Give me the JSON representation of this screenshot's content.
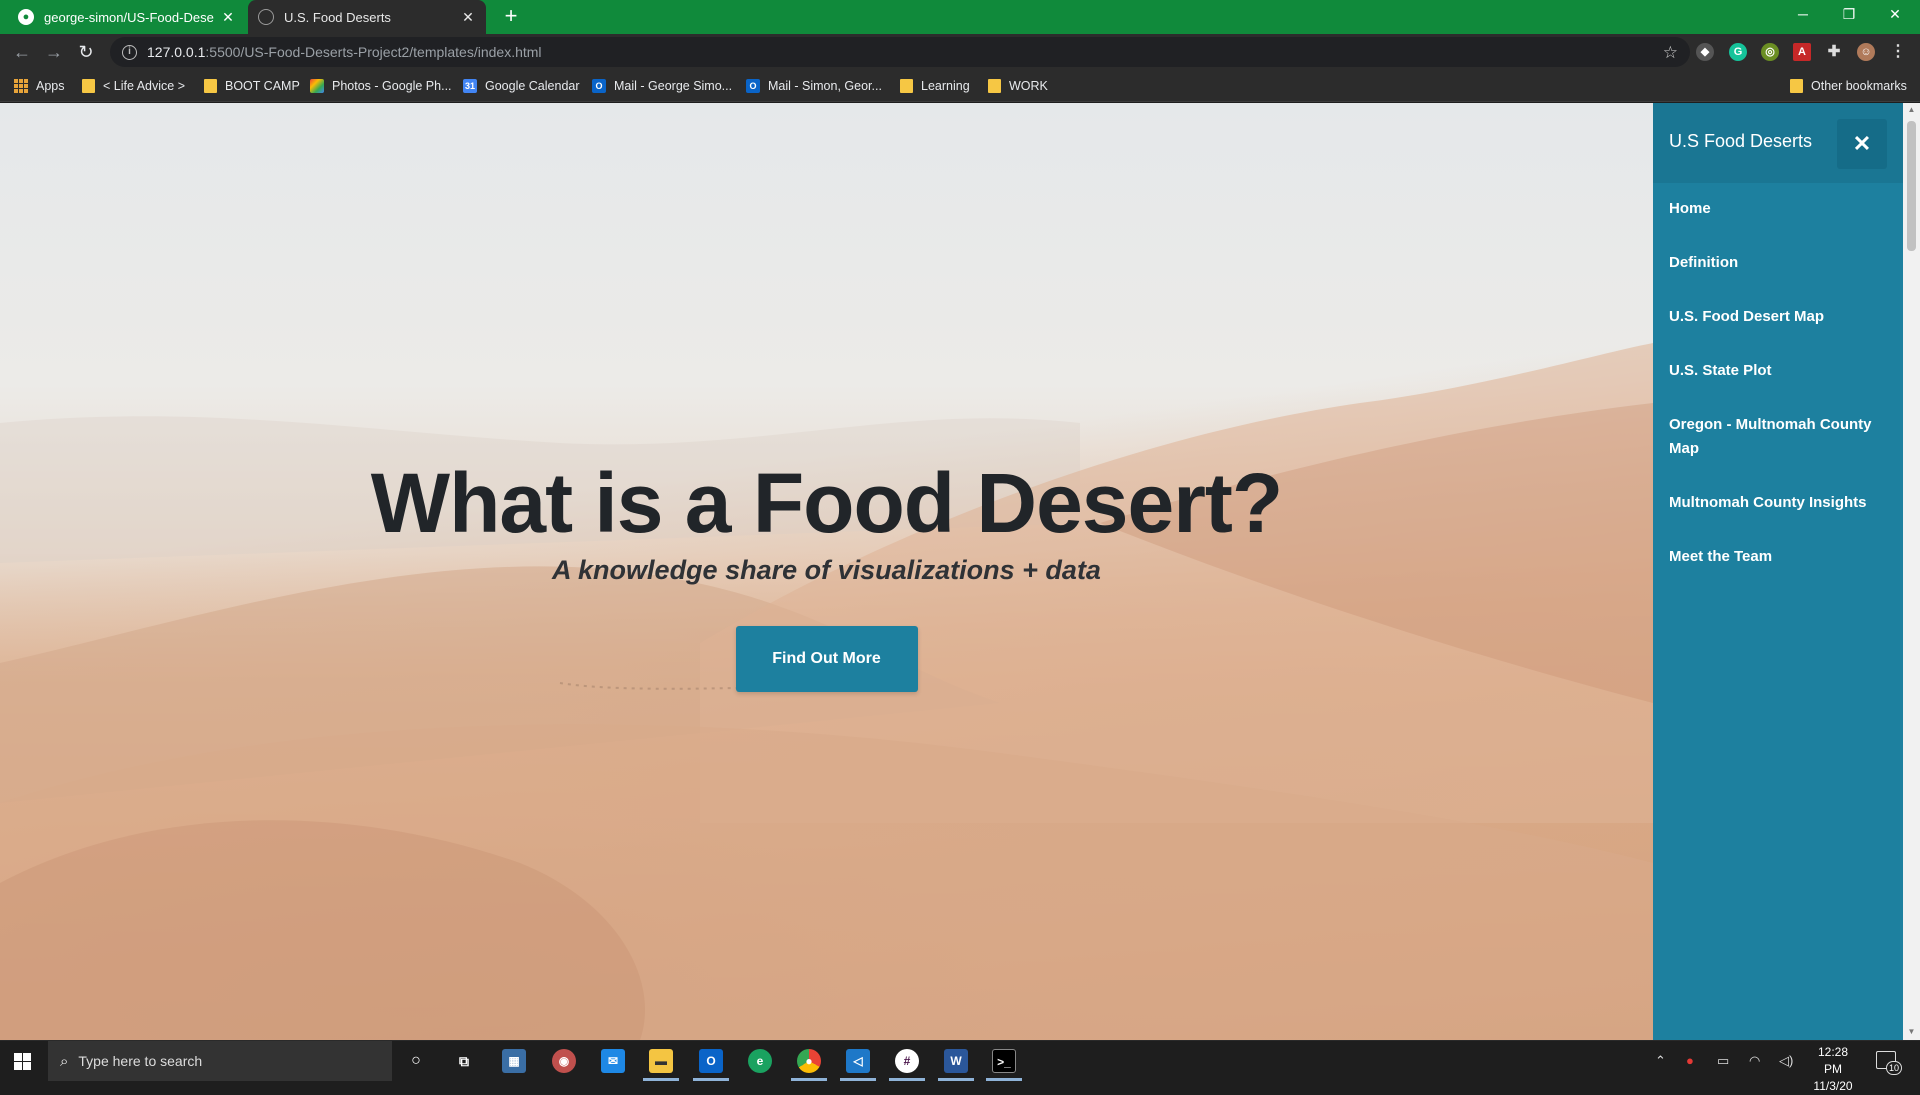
{
  "browser": {
    "tabs": [
      {
        "title": "george-simon/US-Food-Deserts",
        "favicon": "github-icon",
        "active": false
      },
      {
        "title": "U.S. Food Deserts",
        "favicon": "globe-icon",
        "active": true
      }
    ],
    "new_tab": "+",
    "window_controls": {
      "minimize": "─",
      "restore": "❐",
      "close": "✕"
    },
    "address": {
      "host": "127.0.0.1",
      "path": ":5500/US-Food-Deserts-Project2/templates/index.html"
    },
    "bookmarks": [
      {
        "label": "Apps",
        "icon": "apps-grid-icon"
      },
      {
        "label": "< Life Advice >",
        "icon": "folder-icon"
      },
      {
        "label": "BOOT CAMP",
        "icon": "folder-icon"
      },
      {
        "label": "Photos - Google Ph...",
        "icon": "google-photos-icon"
      },
      {
        "label": "Google Calendar",
        "icon": "google-calendar-icon"
      },
      {
        "label": "Mail - George Simo...",
        "icon": "outlook-icon"
      },
      {
        "label": "Mail - Simon, Geor...",
        "icon": "outlook-icon"
      },
      {
        "label": "Learning",
        "icon": "folder-icon"
      },
      {
        "label": "WORK",
        "icon": "folder-icon"
      }
    ],
    "other_bookmarks": "Other bookmarks",
    "colors": {
      "tabbar": "#108a3b",
      "chrome": "#2c2c2c"
    }
  },
  "page": {
    "hero": {
      "title": "What is a Food Desert?",
      "subtitle": "A knowledge share of visualizations + data",
      "button": "Find Out More"
    },
    "sidebar": {
      "brand": "U.S Food Deserts",
      "close": "✕",
      "items": [
        "Home",
        "Definition",
        "U.S. Food Desert Map",
        "U.S. State Plot",
        "Oregon - Multnomah County Map",
        "Multnomah County Insights",
        "Meet the Team"
      ]
    },
    "colors": {
      "accent": "#1d809f",
      "title": "#212529"
    }
  },
  "taskbar": {
    "search_placeholder": "Type here to search",
    "clock": {
      "time": "12:28 PM",
      "date": "11/3/20"
    },
    "notifications": "10"
  }
}
